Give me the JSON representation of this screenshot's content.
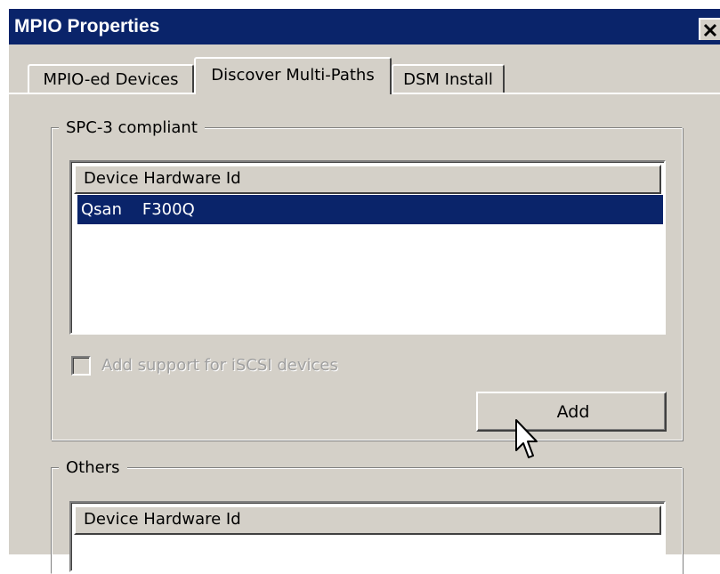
{
  "window": {
    "title": "MPIO Properties",
    "close_glyph": "×"
  },
  "tabs": [
    {
      "label": "MPIO-ed Devices",
      "active": false
    },
    {
      "label": "Discover Multi-Paths",
      "active": true
    },
    {
      "label": "DSM Install",
      "active": false
    }
  ],
  "spc3_group": {
    "title": "SPC-3 compliant",
    "column_header": "Device Hardware Id",
    "rows": [
      "Qsan    F300Q"
    ],
    "checkbox_label": "Add support for iSCSI devices",
    "checkbox_checked": false,
    "checkbox_enabled": false,
    "add_button": "Add"
  },
  "others_group": {
    "title": "Others",
    "column_header": "Device Hardware Id"
  },
  "colors": {
    "title_bar": "#0a246a",
    "face": "#d4d0c8",
    "selection": "#0a246a"
  },
  "icons": {
    "close": "close-icon",
    "cursor": "mouse-pointer-icon"
  }
}
